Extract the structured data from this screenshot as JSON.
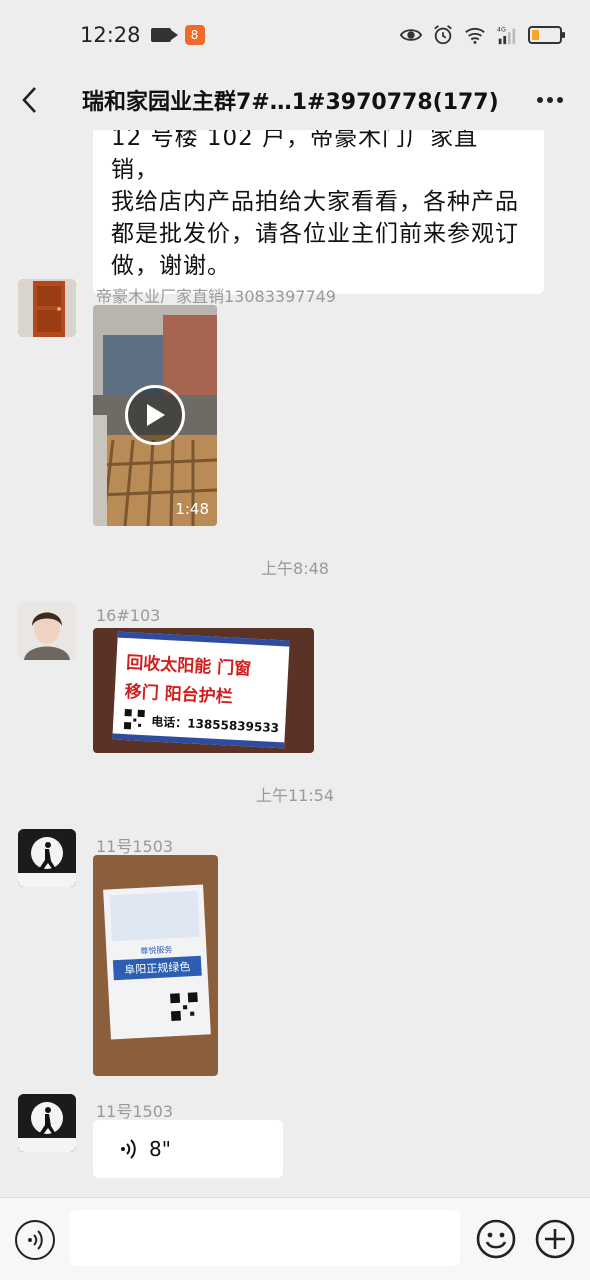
{
  "status_bar": {
    "time": "12:28",
    "network": "4G",
    "battery_percent": 25,
    "battery_color": "#f5a623"
  },
  "nav": {
    "title": "瑞和家园业主群7#…1#3970778(177)",
    "back_icon": "chevron-left-icon",
    "more_icon": "ellipsis-icon"
  },
  "messages": [
    {
      "type": "text",
      "lines": [
        "12 号楼 102 户，帝豪木门厂家直销，",
        "我给店内产品拍给大家看看，各种产品",
        "都是批发价，请各位业主们前来参观订",
        "做，谢谢。"
      ]
    },
    {
      "type": "video",
      "sender": "帝豪木业厂家直销13083397749",
      "duration": "1:48"
    },
    {
      "type": "time",
      "text": "上午8:48"
    },
    {
      "type": "image",
      "sender": "16#103",
      "sign": {
        "line1": "回收太阳能 门窗",
        "line2": "移门 阳台护栏",
        "phone": "电话：13855839533"
      }
    },
    {
      "type": "time",
      "text": "上午11:54"
    },
    {
      "type": "image",
      "sender": "11号1503",
      "flyer": {
        "headline": "尊悦服务",
        "title": "阜阳正规绿色"
      }
    },
    {
      "type": "voice",
      "sender": "11号1503",
      "duration": "8\""
    }
  ],
  "input_bar": {
    "placeholder": "",
    "voice_icon": "voice-toggle-icon",
    "emoji_icon": "emoji-icon",
    "plus_icon": "plus-icon"
  }
}
